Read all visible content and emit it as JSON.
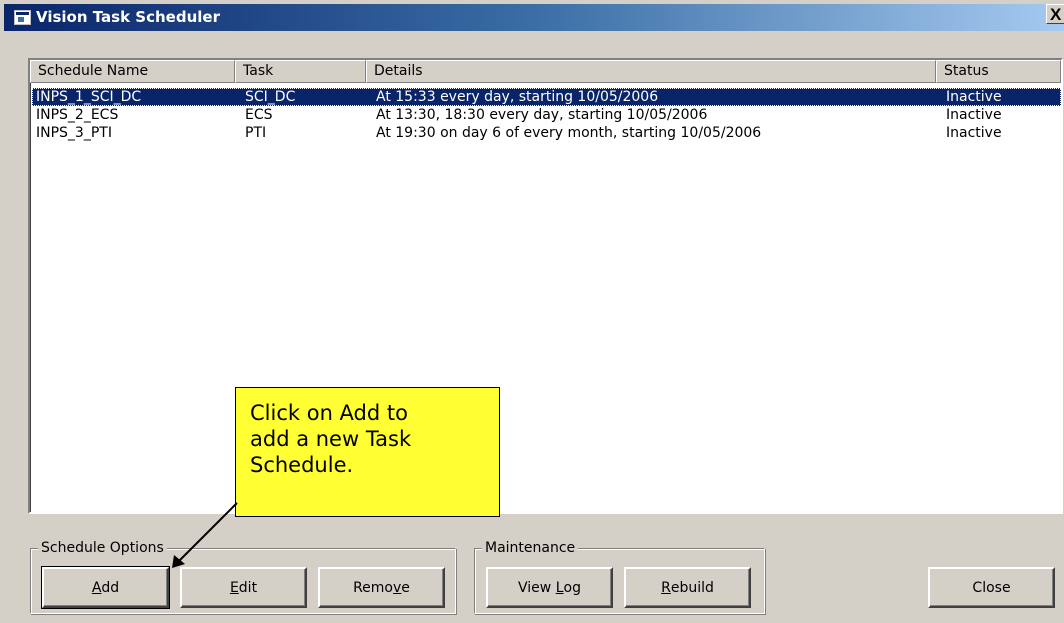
{
  "window": {
    "title": "Vision Task Scheduler",
    "close_glyph": "X",
    "colors": {
      "titlebar_start": "#0a246a",
      "titlebar_end": "#a6caf0",
      "selection": "#0a246a",
      "face": "#d4d0c8",
      "callout": "#ffff33"
    }
  },
  "list": {
    "columns": [
      "Schedule Name",
      "Task",
      "Details",
      "Status"
    ],
    "rows": [
      {
        "name": "INPS_1_SCI_DC",
        "task": "SCI_DC",
        "details": "At 15:33 every day, starting 10/05/2006",
        "status": "Inactive",
        "selected": true
      },
      {
        "name": "INPS_2_ECS",
        "task": "ECS",
        "details": "At 13:30, 18:30 every day, starting 10/05/2006",
        "status": "Inactive",
        "selected": false
      },
      {
        "name": "INPS_3_PTI",
        "task": "PTI",
        "details": "At 19:30 on day 6 of every month, starting 10/05/2006",
        "status": "Inactive",
        "selected": false
      }
    ]
  },
  "schedule_options": {
    "label": "Schedule Options",
    "add": {
      "pre": "",
      "key": "A",
      "post": "dd"
    },
    "edit": {
      "pre": "",
      "key": "E",
      "post": "dit"
    },
    "remove": {
      "pre": "Remo",
      "key": "v",
      "post": "e"
    }
  },
  "maintenance": {
    "label": "Maintenance",
    "view_log": {
      "pre": "View ",
      "key": "L",
      "post": "og"
    },
    "rebuild": {
      "pre": "",
      "key": "R",
      "post": "ebuild"
    }
  },
  "close_button": "Close",
  "callout": {
    "lines": [
      "Click on Add to",
      "add a new Task",
      "Schedule."
    ]
  }
}
